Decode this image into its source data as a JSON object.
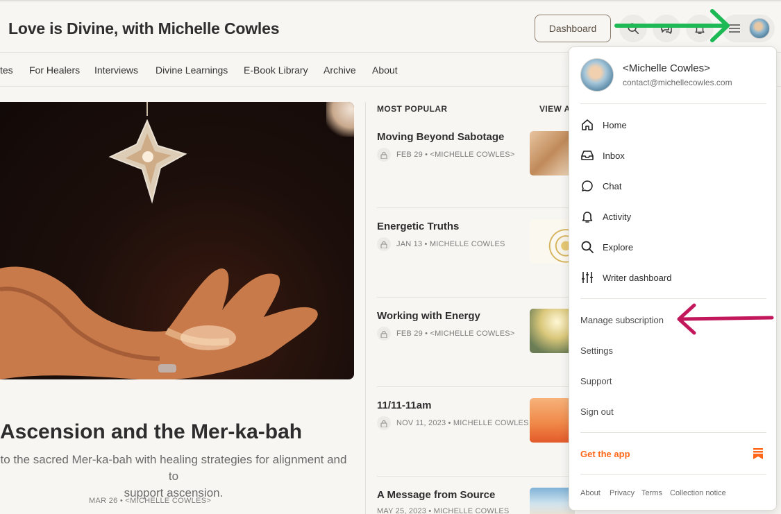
{
  "header": {
    "site_title": "Love is Divine, with Michelle Cowles",
    "dashboard_label": "Dashboard",
    "icons": [
      "search-icon",
      "chat-icon",
      "bell-icon",
      "menu-icon"
    ]
  },
  "nav": {
    "items": [
      "tes",
      "For Healers",
      "Interviews",
      "Divine Learnings",
      "E-Book Library",
      "Archive",
      "About"
    ]
  },
  "hero": {
    "title": "Ascension and the Mer-ka-bah",
    "subtitle_line1": "to the sacred Mer-ka-bah with healing strategies for alignment and to",
    "subtitle_line2": "support ascension.",
    "meta": "MAR 26 • <MICHELLE COWLES>"
  },
  "popular": {
    "heading": "MOST POPULAR",
    "view_all": "VIEW AL",
    "posts": [
      {
        "title": "Moving Beyond Sabotage",
        "meta": "FEB 29 • <MICHELLE COWLES>"
      },
      {
        "title": "Energetic Truths",
        "meta": "JAN 13 • MICHELLE COWLES"
      },
      {
        "title": "Working with Energy",
        "meta": "FEB 29 • <MICHELLE COWLES>"
      },
      {
        "title": "11/11-11am",
        "meta": "NOV 11, 2023 • MICHELLE COWLES"
      },
      {
        "title": "A Message from Source",
        "meta": "MAY 25, 2023 • MICHELLE COWLES"
      }
    ]
  },
  "menu": {
    "name": "<Michelle Cowles>",
    "email": "contact@michellecowles.com",
    "items": [
      {
        "label": "Home",
        "icon": "home-icon"
      },
      {
        "label": "Inbox",
        "icon": "inbox-icon"
      },
      {
        "label": "Chat",
        "icon": "chat-bubble-icon"
      },
      {
        "label": "Activity",
        "icon": "bell-icon"
      },
      {
        "label": "Explore",
        "icon": "search-icon"
      },
      {
        "label": "Writer dashboard",
        "icon": "sliders-icon"
      }
    ],
    "secondary": [
      "Manage subscription",
      "Settings",
      "Support",
      "Sign out"
    ],
    "get_app": "Get the app",
    "footer": [
      "About",
      "Privacy",
      "Terms",
      "Collection notice"
    ]
  },
  "colors": {
    "accent_orange": "#ff6719",
    "arrow_green": "#1db954",
    "arrow_magenta": "#c2185b"
  }
}
